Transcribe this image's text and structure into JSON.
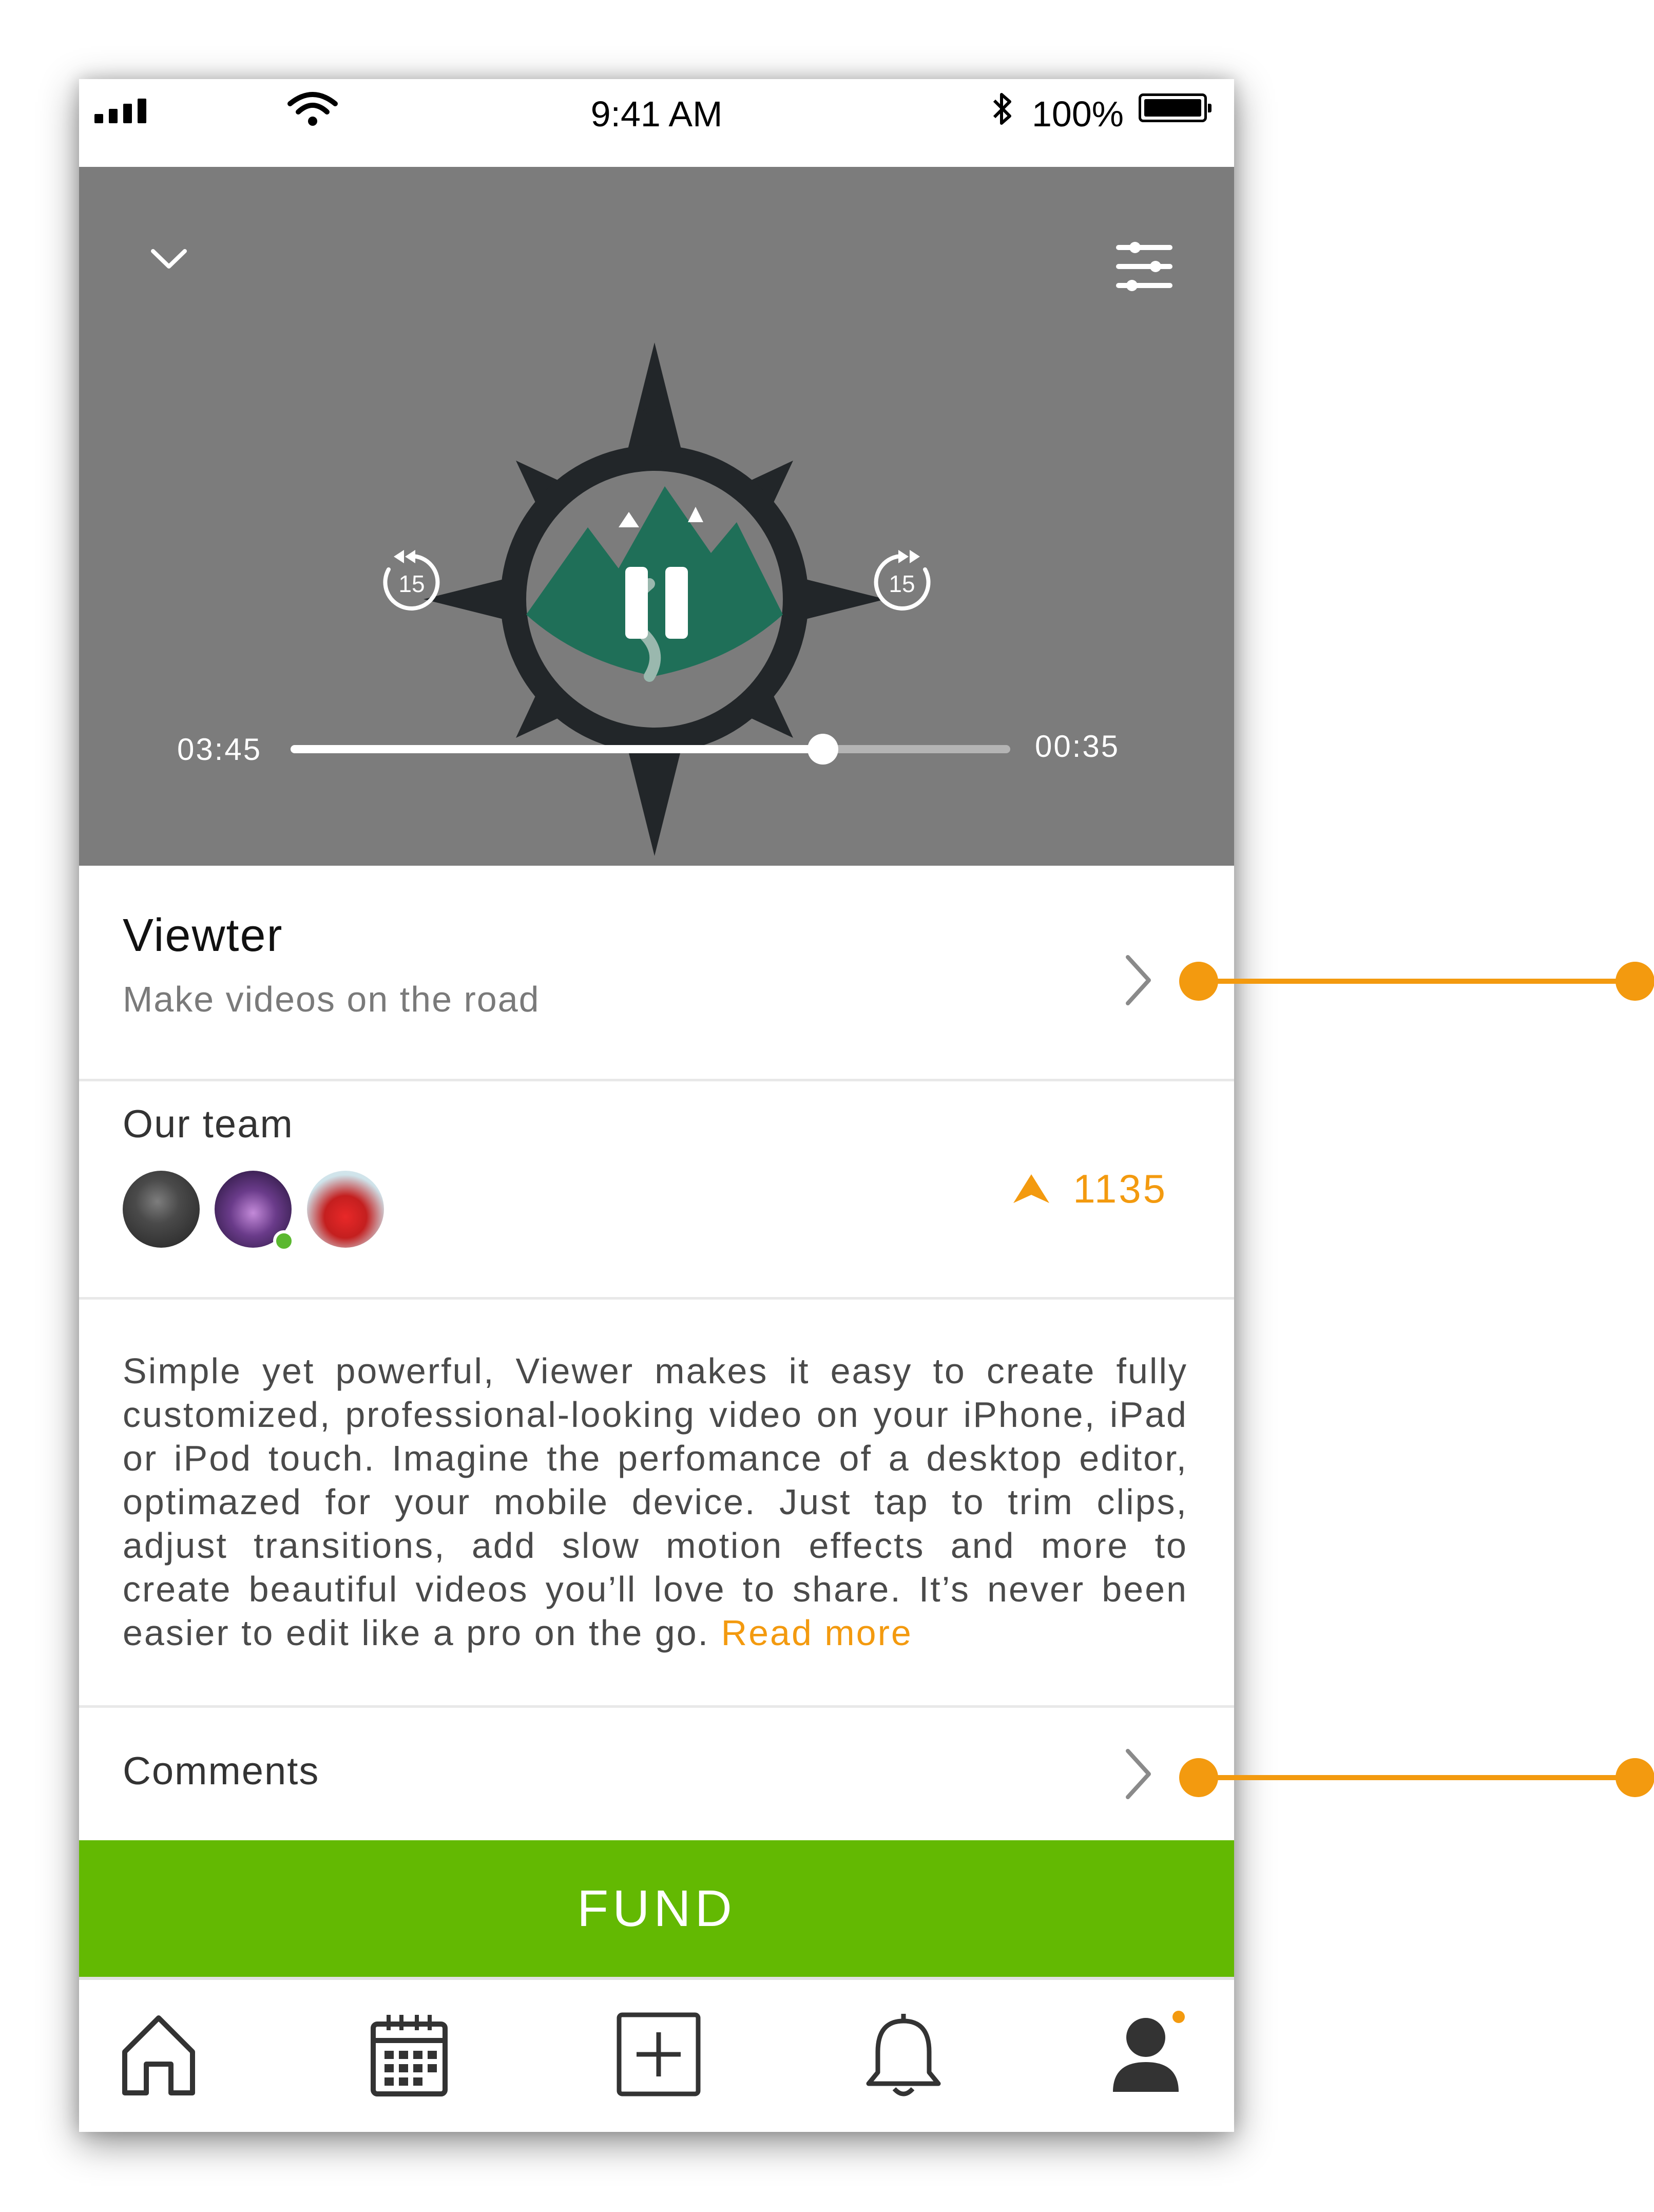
{
  "status_bar": {
    "time": "9:41 AM",
    "battery_percent": "100%",
    "icons": [
      "signal-icon",
      "wifi-icon",
      "bluetooth-icon",
      "battery-icon"
    ]
  },
  "player": {
    "elapsed": "03:45",
    "remaining": "00:35",
    "progress": 0.74,
    "controls": {
      "collapse": "chevron-down-icon",
      "settings": "sliders-icon",
      "rewind": "rewind-15-icon",
      "rewind_label": "15",
      "forward": "forward-15-icon",
      "forward_label": "15",
      "play_state": "pause-icon"
    }
  },
  "project": {
    "title": "Viewter",
    "subtitle": "Make videos on the road"
  },
  "team": {
    "label": "Our team",
    "vote_count": "1135",
    "members": [
      {
        "name": "member-1",
        "online": false
      },
      {
        "name": "member-2",
        "online": true
      },
      {
        "name": "member-3",
        "online": false
      }
    ]
  },
  "description": {
    "text": "Simple yet powerful, Viewer makes it easy to create fully customized, professional-looking video on your iPhone, iPad or iPod touch. Imagine the perfomance of a desktop editor, optimazed for your mobile device. Just tap to trim clips, adjust transitions, add slow motion effects and more to create beautiful videos you’ll love to share. It’s never been easier to edit like a pro on the go.",
    "read_more": "Read more"
  },
  "comments": {
    "label": "Comments"
  },
  "fund_button": {
    "label": "FUND"
  },
  "tab_bar": {
    "items": [
      {
        "icon": "home-icon"
      },
      {
        "icon": "calendar-icon"
      },
      {
        "icon": "add-icon"
      },
      {
        "icon": "bell-icon"
      },
      {
        "icon": "profile-icon",
        "badge": true
      }
    ]
  },
  "colors": {
    "accent": "#f39a0f",
    "fund_green": "#63b902",
    "video_bg": "#7c7c7c",
    "online_green": "#5bb830"
  }
}
